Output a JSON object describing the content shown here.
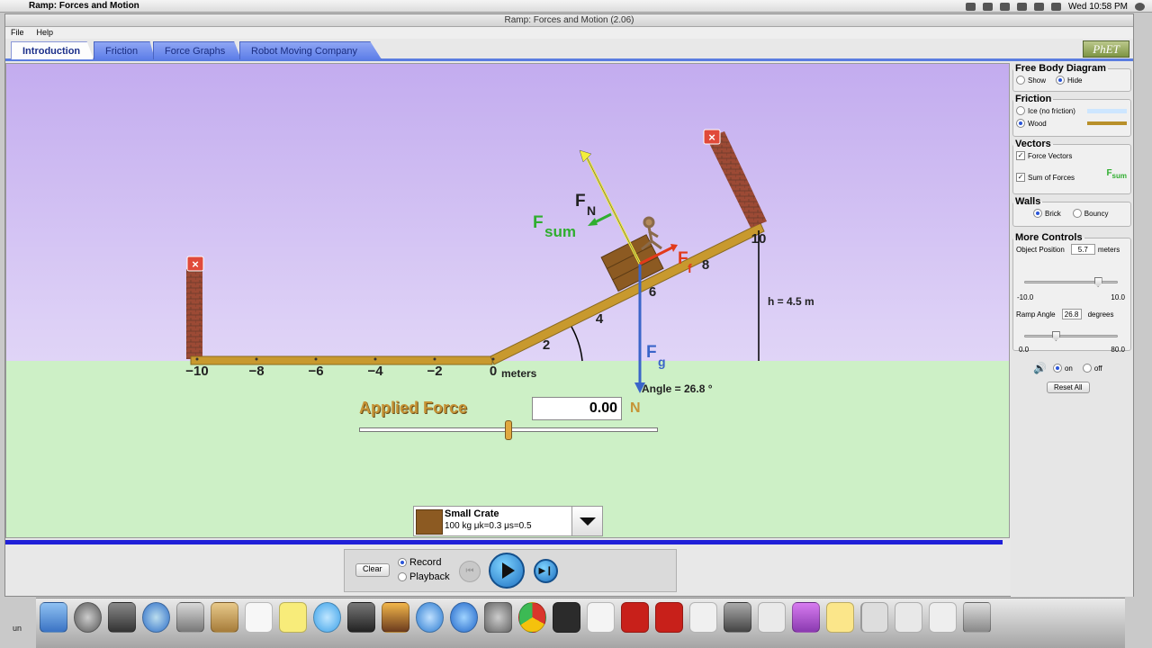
{
  "menubar": {
    "apple": "",
    "app_name": "Ramp: Forces and Motion",
    "clock": "Wed 10:58 PM"
  },
  "window": {
    "title": "Ramp: Forces and Motion (2.06)",
    "menus": [
      "File",
      "Help"
    ]
  },
  "tabs": [
    {
      "label": "Introduction",
      "active": true
    },
    {
      "label": "Friction",
      "active": false
    },
    {
      "label": "Force Graphs",
      "active": false
    },
    {
      "label": "Robot Moving Company",
      "active": false
    }
  ],
  "logo": "PhET",
  "scene": {
    "ramp_angle_deg": 26.8,
    "object_position_m": 5.7,
    "x_ticks": [
      "−10",
      "−8",
      "−6",
      "−4",
      "−2",
      "0"
    ],
    "meters_label": "meters",
    "ramp_ticks": [
      "2",
      "4",
      "6",
      "8",
      "10"
    ],
    "height_label": "h = 4.5 m",
    "angle_label": "Angle = 26.8 °",
    "vector_labels": {
      "fn_main": "F",
      "fn_sub": "N",
      "fsum_main": "F",
      "fsum_sub": "sum",
      "ff_main": "F",
      "ff_sub": "f",
      "fg_main": "F",
      "fg_sub": "g"
    },
    "applied_force": {
      "label": "Applied Force",
      "value": "0.00",
      "unit": "N",
      "level": 0.5
    },
    "object": {
      "name": "Small Crate",
      "details": "100 kg μk=0.3 μs=0.5"
    },
    "colors": {
      "normal": "#f3ee3a",
      "sum": "#2fae2f",
      "friction": "#e23a1a",
      "gravity": "#3a65c9",
      "ramp": "#c8992e",
      "applied_label": "#c69436"
    }
  },
  "panel": {
    "fbd": {
      "title": "Free Body Diagram",
      "options": [
        "Show",
        "Hide"
      ],
      "selected": "Hide"
    },
    "friction": {
      "title": "Friction",
      "options": [
        "Ice (no friction)",
        "Wood"
      ],
      "selected": "Wood"
    },
    "vectors": {
      "title": "Vectors",
      "options": [
        "Force Vectors",
        "Sum of Forces"
      ],
      "checked": [
        true,
        true
      ],
      "legend_main": "F",
      "legend_sub": "sum"
    },
    "walls": {
      "title": "Walls",
      "options": [
        "Brick",
        "Bouncy"
      ],
      "selected": "Brick"
    },
    "more": {
      "title": "More Controls",
      "position_label": "Object Position",
      "position_value": "5.7",
      "position_unit": "meters",
      "position_min": "-10.0",
      "position_max": "10.0",
      "position_level": 0.785,
      "angle_label": "Ramp Angle",
      "angle_value": "26.8",
      "angle_unit": "degrees",
      "angle_min": "0.0",
      "angle_max": "80.0",
      "angle_level": 0.335
    },
    "sound": {
      "options": [
        "on",
        "off"
      ],
      "selected": "on"
    },
    "reset_label": "Reset All"
  },
  "playback": {
    "clear": "Clear",
    "options": [
      "Record",
      "Playback"
    ],
    "selected": "Record"
  },
  "desktop": {
    "left_label": "un"
  }
}
